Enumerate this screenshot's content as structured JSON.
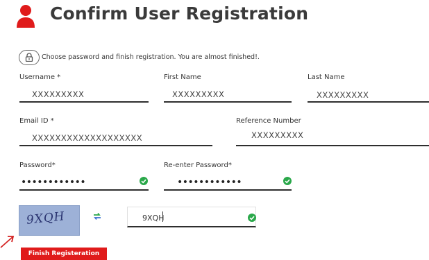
{
  "header": {
    "title": "Confirm User Registration",
    "icon": "user-icon",
    "accent_color": "#e01b1b"
  },
  "info": {
    "icon": "lock-icon",
    "text": "Choose password and finish registration. You are almost finished!."
  },
  "form": {
    "username": {
      "label": "Username *",
      "value": "XXXXXXXXX"
    },
    "first_name": {
      "label": "First Name",
      "value": "XXXXXXXXX"
    },
    "last_name": {
      "label": "Last Name",
      "value": "XXXXXXXXX"
    },
    "email": {
      "label": "Email ID *",
      "value": "XXXXXXXXXXXXXXXXXXX"
    },
    "reference_number": {
      "label": "Reference Number",
      "value": "XXXXXXXXX"
    },
    "password": {
      "label": "Password*",
      "value": "••••••••••••",
      "valid_icon": "check-circle-icon"
    },
    "reenter_password": {
      "label": "Re-enter Password*",
      "value": "••••••••••••",
      "valid_icon": "check-circle-icon"
    },
    "captcha": {
      "image_text": "9XQH",
      "refresh_icon": "refresh-icon",
      "input_value": "9XQH",
      "valid_icon": "check-circle-icon"
    }
  },
  "actions": {
    "finish_label": "Finish Registeration"
  },
  "colors": {
    "valid_green": "#2aa84a",
    "captcha_background": "#9db1d7"
  }
}
